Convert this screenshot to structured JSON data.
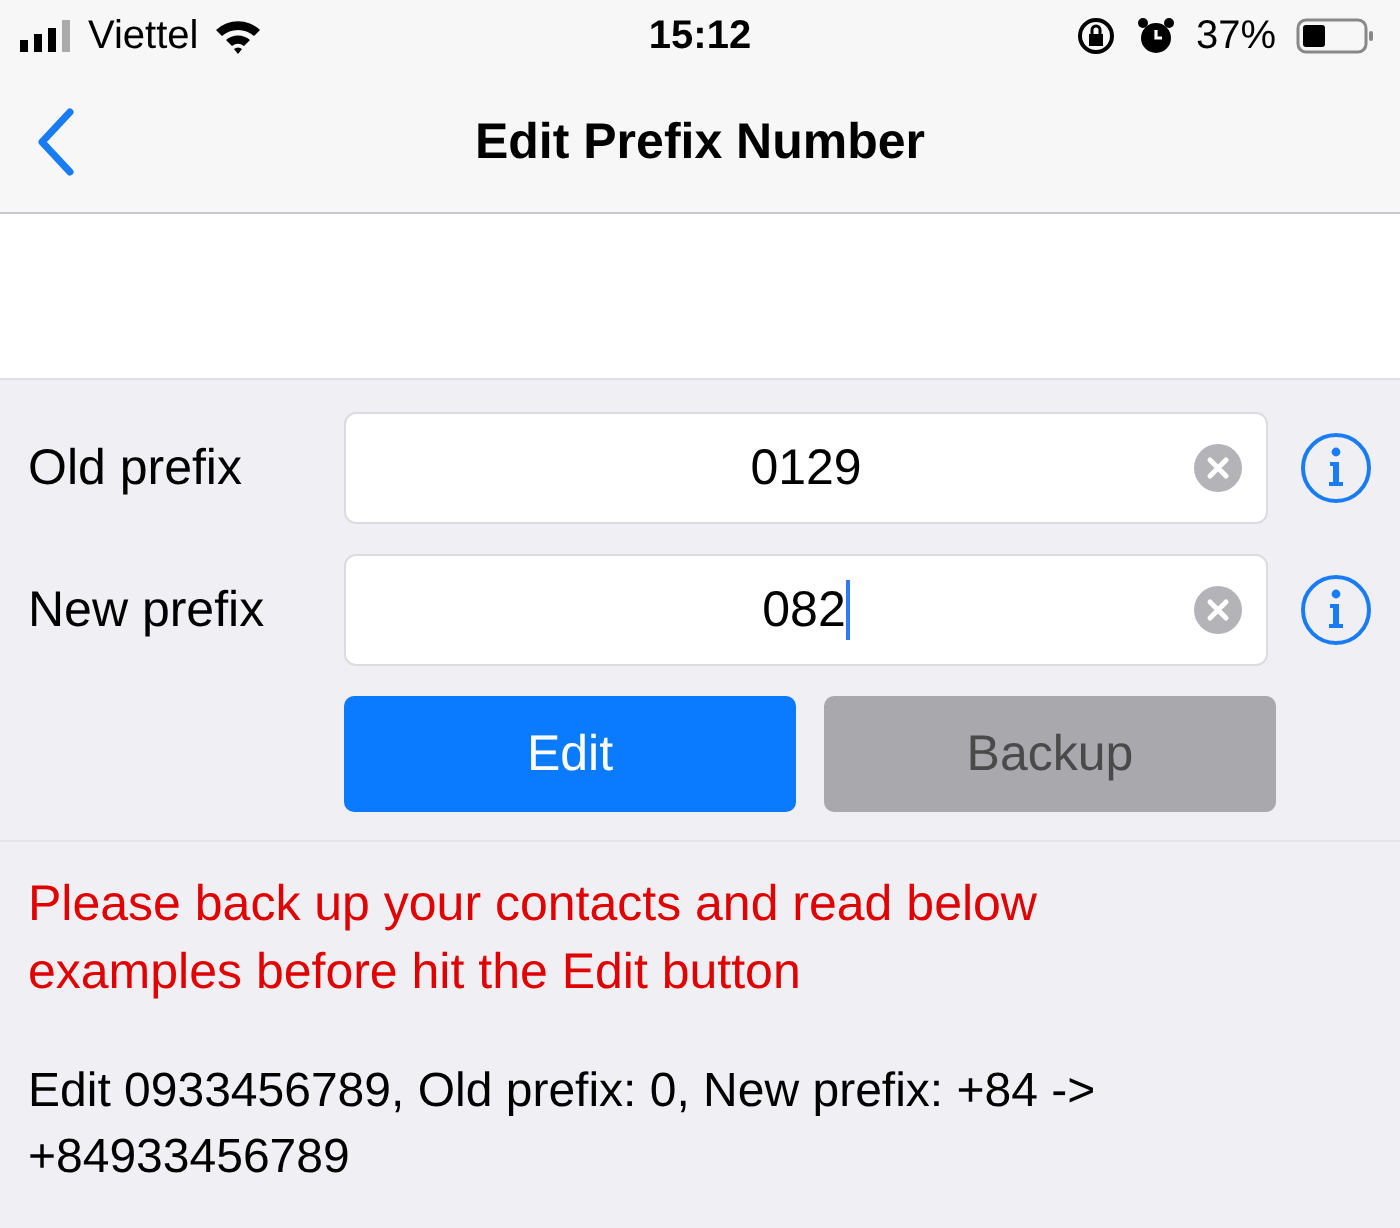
{
  "status_bar": {
    "carrier": "Viettel",
    "time": "15:12",
    "battery": "37%"
  },
  "nav": {
    "title": "Edit Prefix Number"
  },
  "fields": [
    {
      "label": "Old prefix",
      "value": "0129",
      "focused": false
    },
    {
      "label": "New prefix",
      "value": "082",
      "focused": true
    }
  ],
  "buttons": [
    {
      "label": "Edit",
      "disabled": false
    },
    {
      "label": "Backup",
      "disabled": true
    }
  ],
  "warning": "Please back up your contacts and read below examples before hit the Edit button",
  "example": "Edit 0933456789, Old prefix: 0, New prefix: +84 -> +84933456789"
}
